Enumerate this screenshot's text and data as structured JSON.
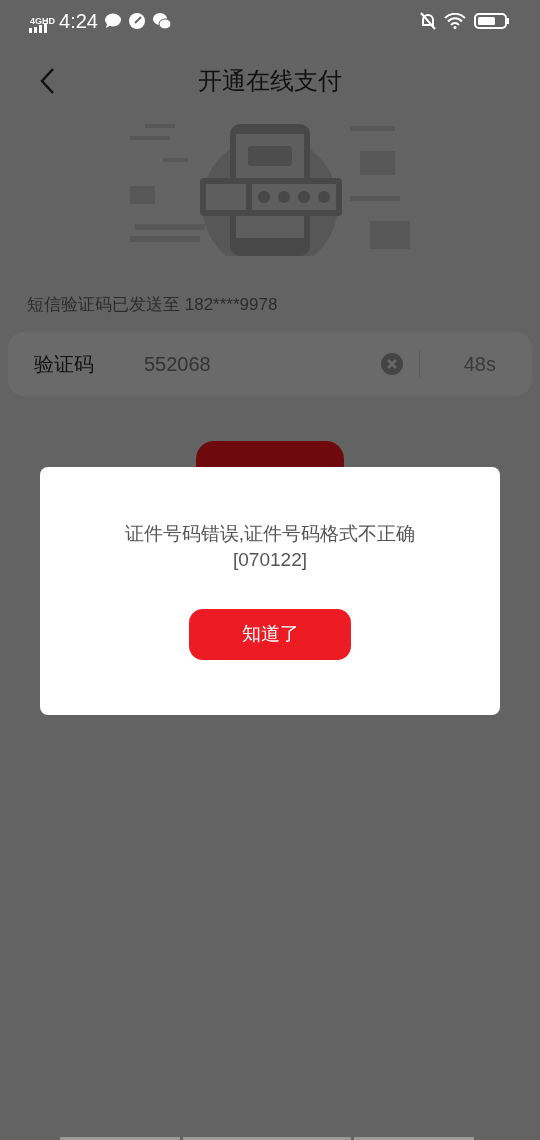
{
  "status_bar": {
    "network": "4GHD",
    "time": "4:24"
  },
  "header": {
    "title": "开通在线支付"
  },
  "sms_notice": "短信验证码已发送至 182****9978",
  "code_field": {
    "label": "验证码",
    "value": "552068",
    "countdown": "48s"
  },
  "dialog": {
    "message_lines": [
      "证件号码错误,证件号码格式不正确",
      "[070122]"
    ],
    "button": "知道了"
  }
}
